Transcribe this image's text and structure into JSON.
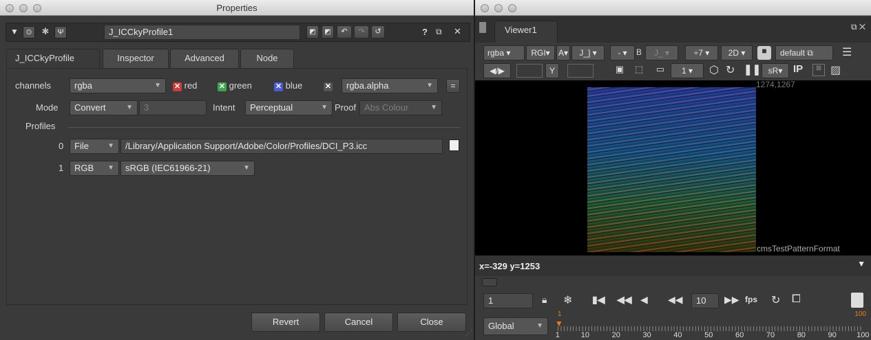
{
  "properties": {
    "window_title": "Properties",
    "node_name": "J_ICCkyProfile1",
    "help": "?",
    "tabs": [
      {
        "label": "J_ICCkyProfile"
      },
      {
        "label": "Inspector"
      },
      {
        "label": "Advanced"
      },
      {
        "label": "Node"
      }
    ],
    "channels": {
      "label": "channels",
      "value": "rgba",
      "red": "red",
      "green": "green",
      "blue": "blue",
      "alpha_value": "rgba.alpha",
      "eq": "="
    },
    "mode": {
      "label": "Mode",
      "value": "Convert",
      "number": "3",
      "intent_label": "Intent",
      "intent_value": "Perceptual",
      "proof_label": "Proof",
      "proof_value": "Abs Colour"
    },
    "profiles": {
      "label": "Profiles",
      "rows": [
        {
          "index": "0",
          "type": "File",
          "value": "/Library/Application Support/Adobe/Color/Profiles/DCI_P3.icc"
        },
        {
          "index": "1",
          "type": "RGB",
          "value": "sRGB (IEC61966-21)"
        }
      ]
    },
    "buttons": {
      "revert": "Revert",
      "cancel": "Cancel",
      "close": "Close"
    }
  },
  "viewer": {
    "tab": "Viewer1",
    "toolbar1": {
      "channels": "rgba",
      "rgb": "RGI",
      "alpha": "A",
      "input_a": "J_]",
      "dash": "-",
      "b_label": "B",
      "input_b": "J_",
      "gain": "÷7",
      "mode2d": "2D",
      "lut": "default"
    },
    "toolbar2": {
      "y_label": "Y",
      "frame": "1",
      "colorspace": "sR",
      "ip": "IP"
    },
    "bbox_label": "1274,1267",
    "format_label": "cmsTestPatternFormat",
    "coords": "x=-329 y=1253",
    "timeline": {
      "frame": "1",
      "step": "10",
      "fps": "fps",
      "range": "Global",
      "start_marker": "1",
      "end_marker": "100",
      "ticks": [
        "1",
        "10",
        "20",
        "30",
        "40",
        "50",
        "60",
        "70",
        "80",
        "90",
        "100"
      ]
    }
  },
  "colors": {
    "panel": "#3a3a3a",
    "input": "#4a4a4a",
    "red_check": "#d03a3a",
    "green_check": "#3aa84a",
    "blue_check": "#4a5ad8",
    "marker": "#e8801a"
  }
}
